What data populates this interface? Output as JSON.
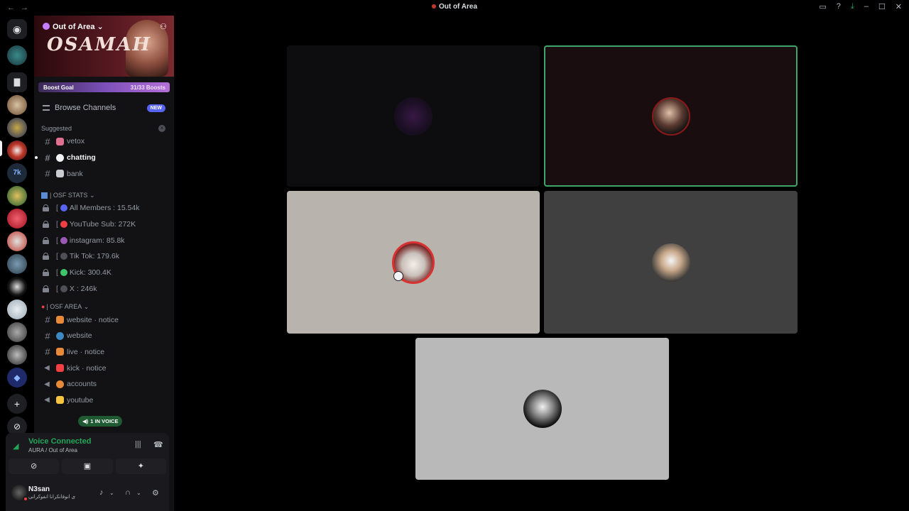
{
  "window": {
    "title": "Out of Area"
  },
  "server": {
    "name": "Out of Area",
    "banner_text": "OSAMAH",
    "boost": {
      "label": "Boost Goal",
      "progress": "31/33 Boosts"
    },
    "browse_channels": "Browse Channels",
    "new_badge": "NEW"
  },
  "suggested": {
    "label": "Suggested",
    "channels": [
      {
        "name": "vetox",
        "icon": "gift-emoji"
      },
      {
        "name": "chatting",
        "icon": "speech-bubble-emoji"
      },
      {
        "name": "bank",
        "icon": "bank-emoji"
      }
    ]
  },
  "stats_category": {
    "label": "| OSF STATS",
    "channels": [
      {
        "name": "All Members : 15.54k",
        "color": "#5865f2"
      },
      {
        "name": "YouTube Sub: 272K",
        "color": "#f23f43"
      },
      {
        "name": "instagram: 85.8k",
        "color": "#9b59b6"
      },
      {
        "name": "Tik Tok: 179.6k",
        "color": "#4e5058"
      },
      {
        "name": "Kick: 300.4K",
        "color": "#53fc18"
      },
      {
        "name": "X : 246k",
        "color": "#4e5058"
      }
    ]
  },
  "area_category": {
    "label": "| OSF AREA",
    "channels": [
      {
        "name": "website · notice",
        "type": "text"
      },
      {
        "name": "website",
        "type": "text"
      },
      {
        "name": "live · notice",
        "type": "text"
      },
      {
        "name": "kick · notice",
        "type": "announcement"
      },
      {
        "name": "accounts",
        "type": "announcement"
      },
      {
        "name": "youtube",
        "type": "announcement"
      }
    ]
  },
  "in_voice_badge": "1 IN VOICE",
  "voice": {
    "status": "Voice Connected",
    "location": "AURA / Out of Area"
  },
  "user": {
    "name": "N3san",
    "status": "ى انوفانكرانا انفوكرانى"
  },
  "colors": {
    "accent": "#5865f2",
    "speaking": "#3fa56b",
    "voice_green": "#23a559"
  }
}
